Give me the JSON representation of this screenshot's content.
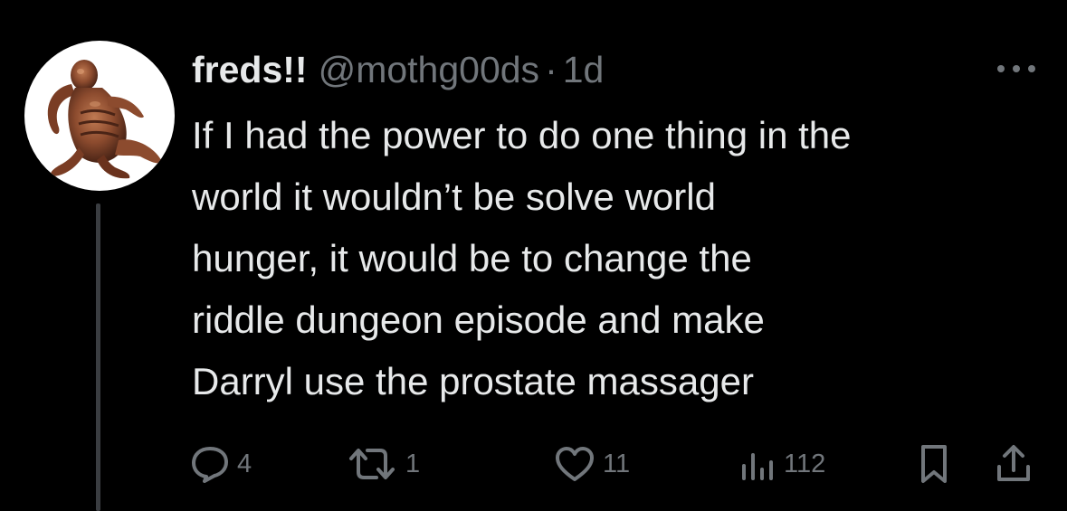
{
  "tweet": {
    "display_name": "freds!!",
    "handle": "@mothg00ds",
    "separator": "·",
    "time": "1d",
    "text": "If I had the power to do one thing in the\nworld it wouldn’t be solve world\nhunger, it would be to change the\nriddle dungeon episode and make\nDarryl use the prostate massager",
    "avatar_icon": "figurine-avatar"
  },
  "actions": {
    "reply_count": "4",
    "retweet_count": "1",
    "like_count": "11",
    "views_count": "112"
  },
  "colors": {
    "background": "#000000",
    "text_primary": "#e7e9ea",
    "text_secondary": "#71767b",
    "thread_line": "#3a3d41"
  }
}
